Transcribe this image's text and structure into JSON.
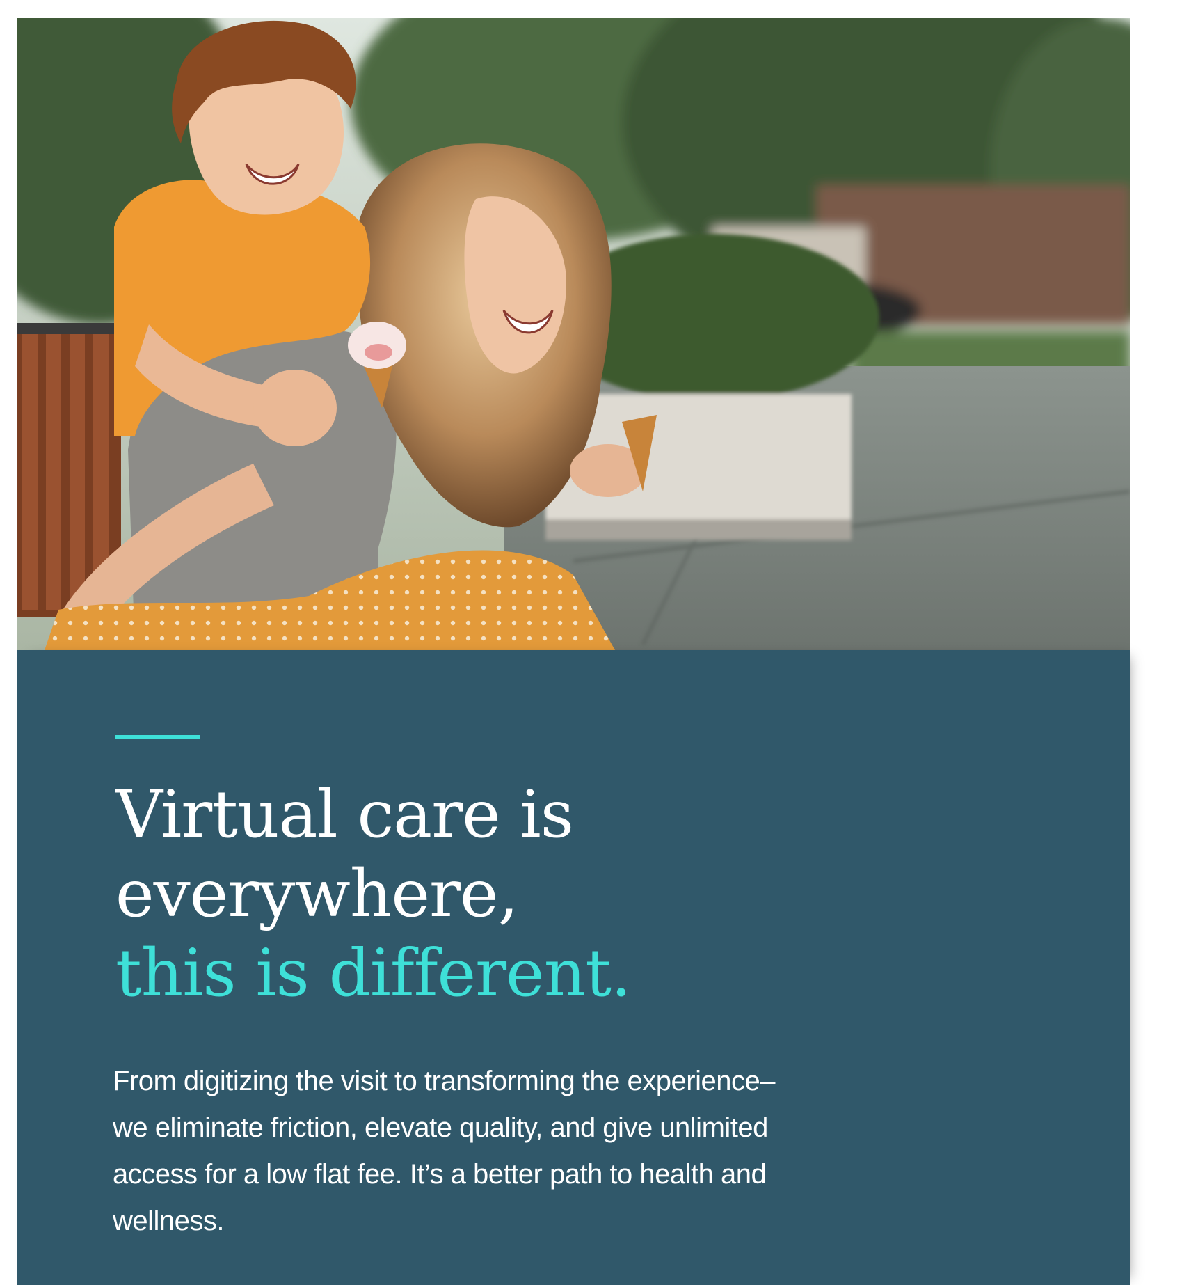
{
  "hero": {
    "image_alt": "Smiling mother and son outdoors holding ice cream cones"
  },
  "content": {
    "headline_line1": "Virtual care is",
    "headline_line2": "everywhere,",
    "headline_accent": "this is different.",
    "body": "From digitizing the visit to transforming the experience–we eliminate friction, elevate quality, and give unlimited access for a low flat fee. It’s a better path to health and wellness."
  },
  "colors": {
    "panel_background": "#30586a",
    "accent": "#3ee0d8",
    "text": "#ffffff"
  }
}
